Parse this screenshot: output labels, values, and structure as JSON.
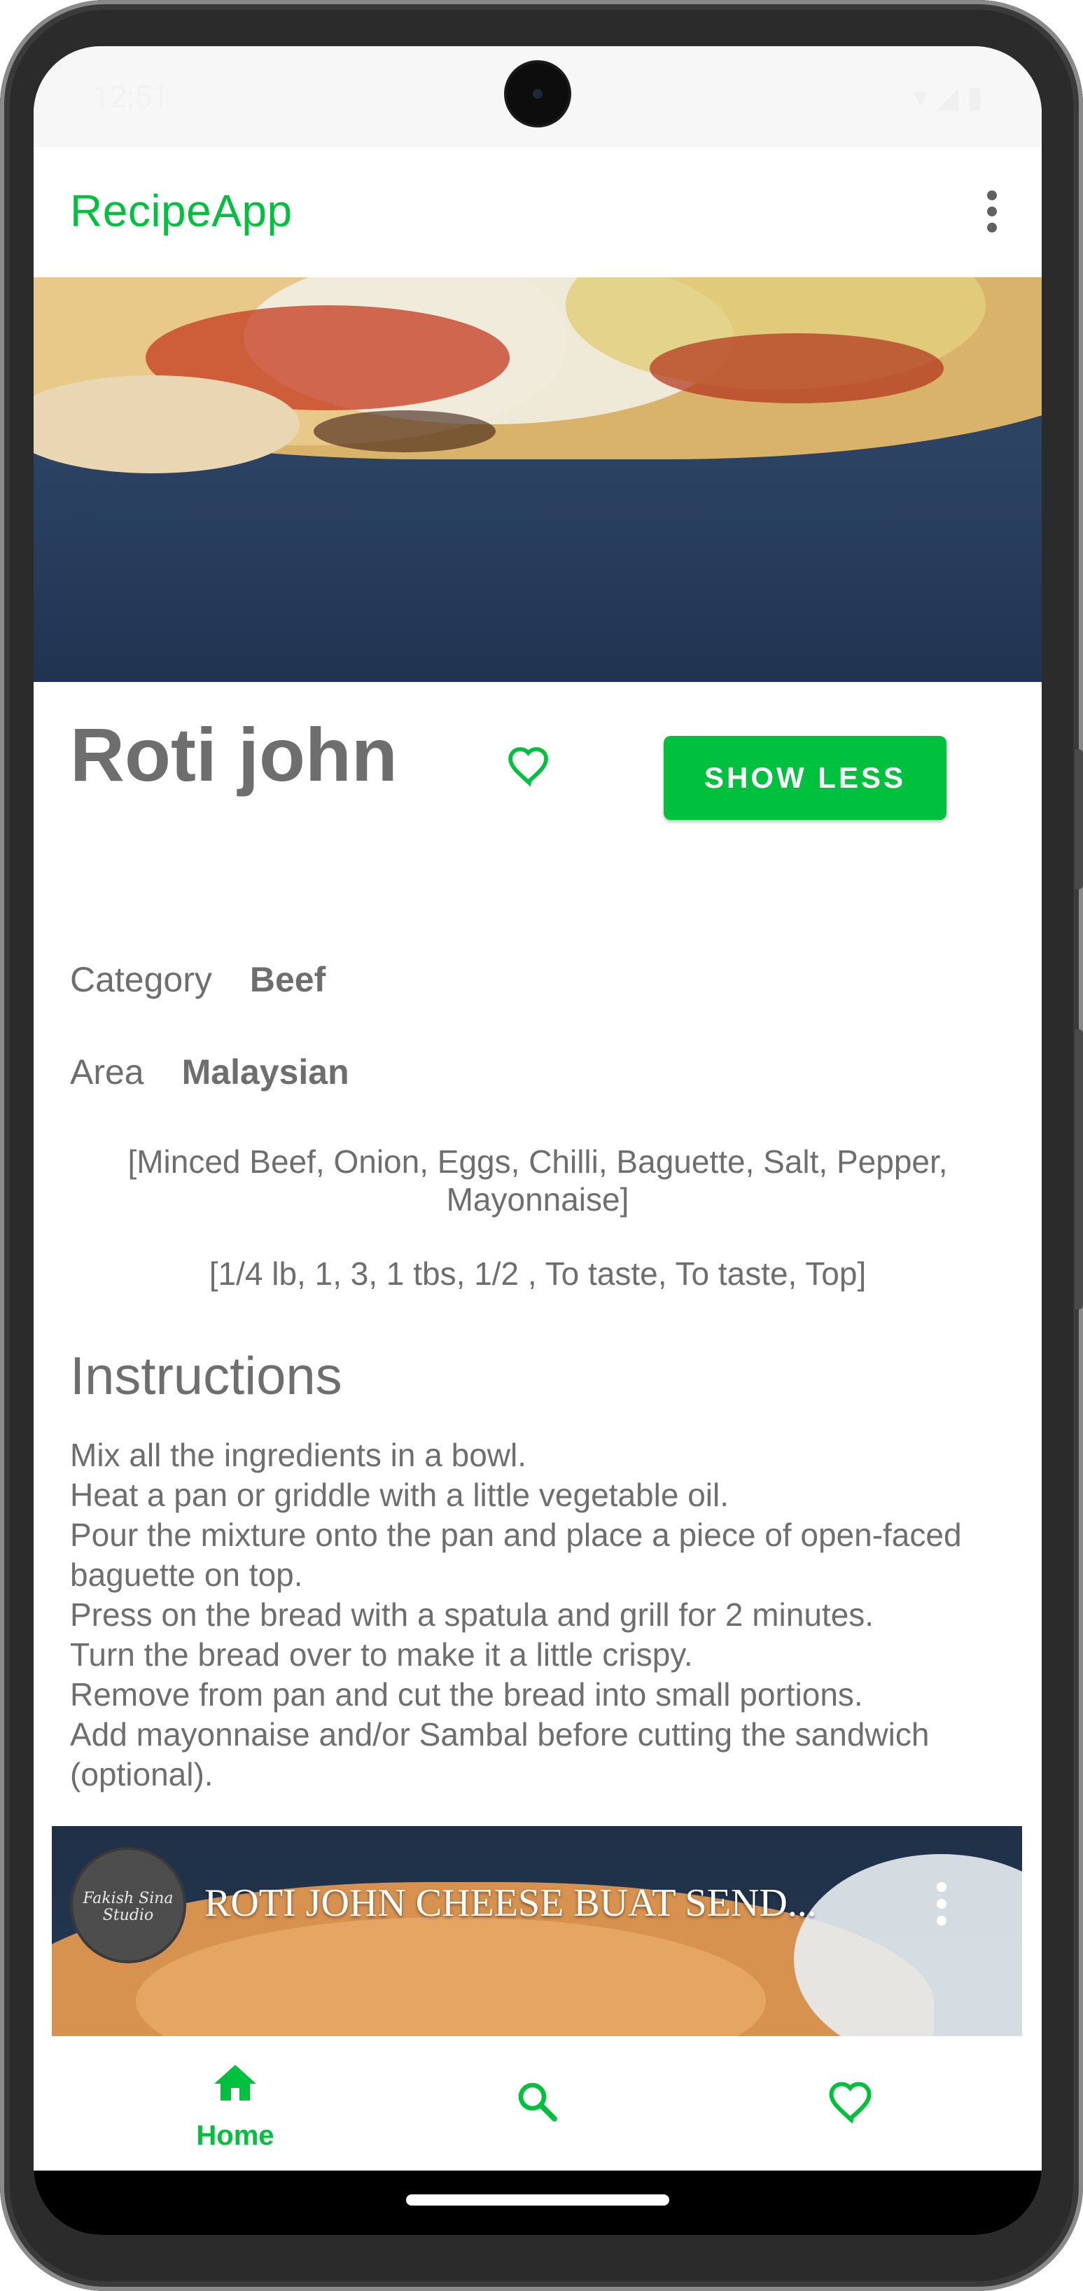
{
  "status_bar": {
    "time": "12:51",
    "icons": [
      "dnd-icon",
      "sync-icon",
      "wifi-icon",
      "signal-icon",
      "battery-icon"
    ]
  },
  "app_bar": {
    "title": "RecipeApp",
    "overflow_icon": "more-vert-icon"
  },
  "meal": {
    "title": "Roti john",
    "favorite_icon": "heart-outline-icon",
    "toggle_button": "SHOW LESS",
    "category_label": "Category",
    "category_value": "Beef",
    "area_label": "Area",
    "area_value": "Malaysian",
    "ingredients": "[Minced Beef, Onion, Eggs, Chilli, Baguette, Salt, Pepper, Mayonnaise]",
    "measures": "[1/4 lb, 1, 3, 1 tbs, 1/2 , To taste, To taste, Top]",
    "instructions_heading": "Instructions",
    "instructions": "Mix all the ingredients in a bowl.\nHeat a pan or griddle with a little vegetable oil.\nPour the mixture onto the pan and place a piece of open-faced baguette on top.\nPress on the bread with a spatula and grill for 2 minutes.\nTurn the bread over to make it a little crispy.\nRemove from pan and cut the bread into small portions.\nAdd mayonnaise and/or Sambal before cutting the sandwich (optional)."
  },
  "video": {
    "title": "ROTI JOHN CHEESE BUAT SEND...",
    "channel_logo_text": "Fakish Sina Studio",
    "menu_icon": "more-vert-icon"
  },
  "bottom_nav": {
    "items": [
      {
        "label": "Home",
        "icon": "home-icon",
        "selected": true
      },
      {
        "label": "",
        "icon": "search-icon",
        "selected": false
      },
      {
        "label": "",
        "icon": "heart-outline-icon",
        "selected": false
      }
    ]
  },
  "colors": {
    "accent": "#00c13d",
    "text": "#6e6e6e",
    "background": "#ffffff"
  }
}
